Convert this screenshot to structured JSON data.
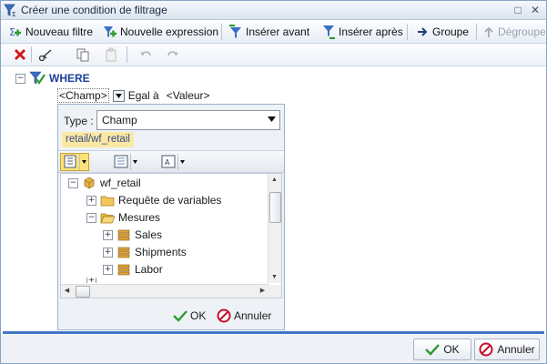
{
  "window": {
    "title": "Créer une condition de filtrage",
    "restore_glyph": "□",
    "close_glyph": "✕"
  },
  "toolbar": {
    "new_filter": "Nouveau filtre",
    "new_expression": "Nouvelle expression",
    "insert_before": "Insérer avant",
    "insert_after": "Insérer après",
    "group": "Groupe",
    "ungroup": "Dégrouper"
  },
  "toolbar2_icons": [
    "delete-icon",
    "cut-icon",
    "copy-icon",
    "paste-icon",
    "undo-icon",
    "redo-icon"
  ],
  "condition": {
    "where_label": "WHERE",
    "field": "<Champ>",
    "operator": "Egal à",
    "value": "<Valeur>"
  },
  "popup": {
    "type_label": "Type :",
    "type_value": "Champ",
    "source": "retail/wf_retail",
    "tree": [
      {
        "label": "wf_retail",
        "level": 0,
        "expander": "⊟"
      },
      {
        "label": "Requête de variables",
        "level": 1,
        "expander": "⊞"
      },
      {
        "label": "Mesures",
        "level": 1,
        "expander": "⊟"
      },
      {
        "label": "Sales",
        "level": 2,
        "expander": "⊞"
      },
      {
        "label": "Shipments",
        "level": 2,
        "expander": "⊞"
      },
      {
        "label": "Labor",
        "level": 2,
        "expander": "⊞"
      }
    ],
    "ok": "OK",
    "cancel": "Annuler"
  },
  "footer": {
    "ok": "OK",
    "cancel": "Annuler"
  },
  "colors": {
    "accent": "#3f74c8",
    "where": "#1d3f9a",
    "source_bg": "#fbe9a3",
    "cancel_red": "#c8102e",
    "ok_green": "#2e9a2e"
  }
}
